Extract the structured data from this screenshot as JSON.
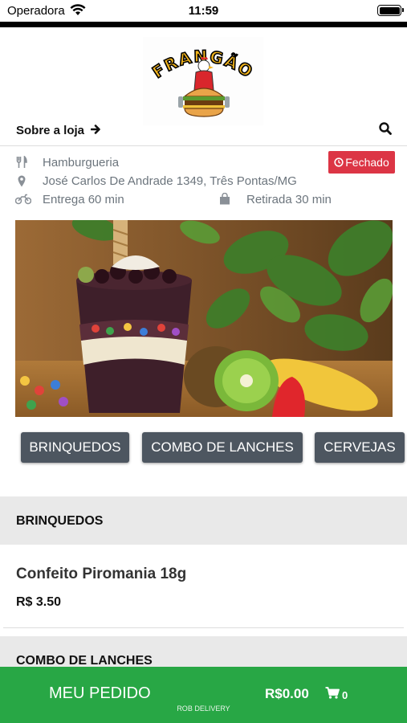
{
  "status_bar": {
    "carrier": "Operadora",
    "time": "11:59"
  },
  "logo": {
    "text": "FRANGÃO"
  },
  "header": {
    "about_label": "Sobre a loja"
  },
  "store_info": {
    "category": "Hamburgueria",
    "address": "José Carlos De Andrade 1349, Três Pontas/MG",
    "delivery": "Entrega 60 min",
    "pickup": "Retirada 30 min",
    "status": "Fechado"
  },
  "category_tabs": [
    "BRINQUEDOS",
    "COMBO DE LANCHES",
    "CERVEJAS"
  ],
  "sections": [
    {
      "title": "BRINQUEDOS"
    },
    {
      "title": "COMBO DE LANCHES"
    }
  ],
  "products": [
    {
      "name": "Confeito Piromania 18g",
      "price": "R$ 3.50"
    }
  ],
  "bottom_bar": {
    "label": "MEU PEDIDO",
    "total": "R$0.00",
    "cart_count": "0",
    "brand": "ROB DELIVERY"
  },
  "colors": {
    "accent_green": "#28a745",
    "closed_red": "#dc3545",
    "tab_gray": "#4d5660"
  }
}
